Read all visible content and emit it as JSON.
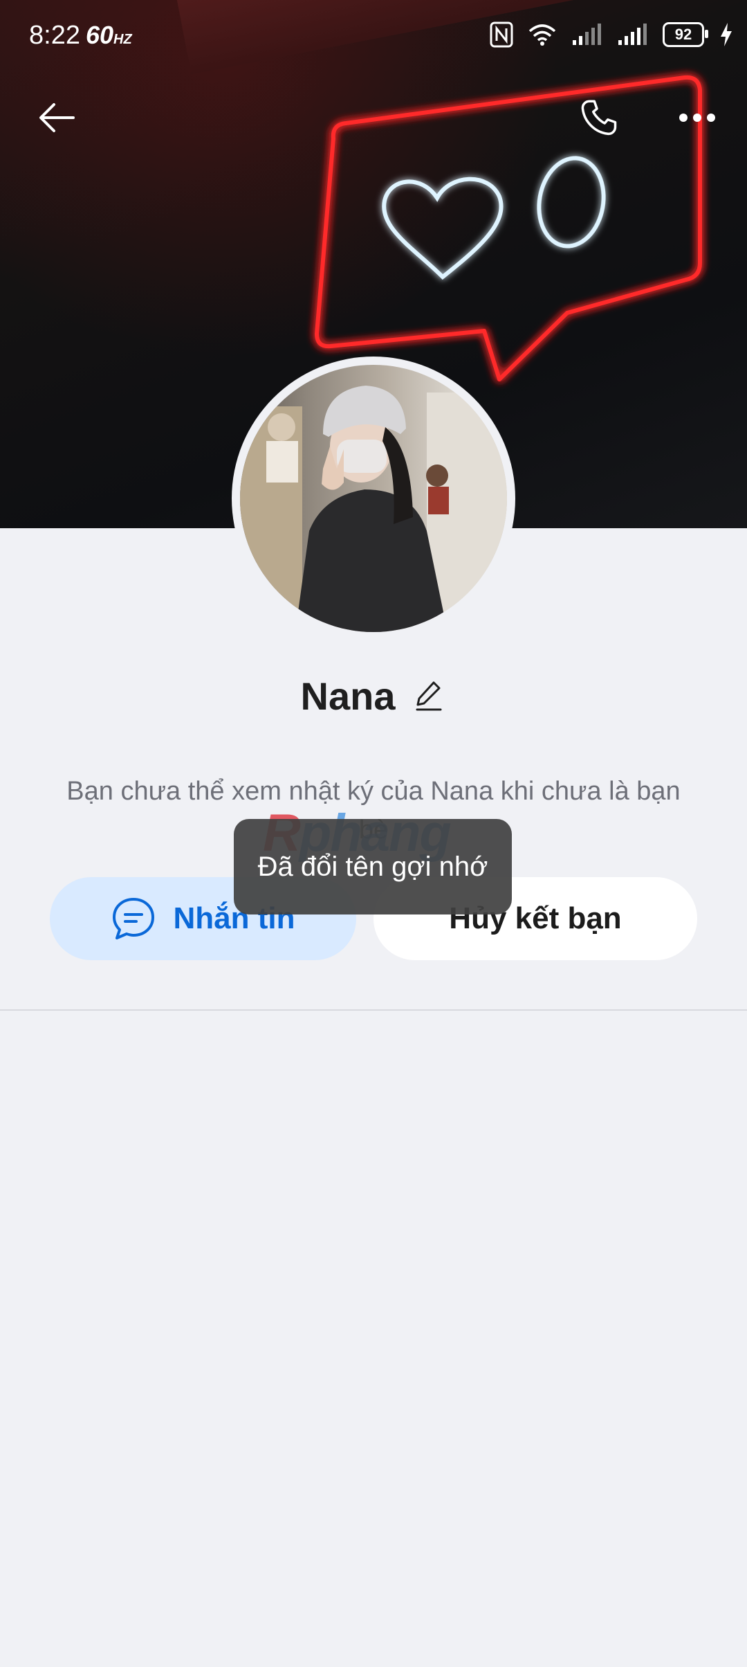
{
  "status_bar": {
    "time": "8:22",
    "refresh": "60",
    "refresh_unit": "HZ",
    "battery": "92",
    "icons": [
      "nfc-icon",
      "wifi-icon",
      "signal-icon",
      "signal-icon",
      "battery-icon",
      "charging-icon"
    ]
  },
  "top_bar": {
    "back_icon": "arrow-left-icon",
    "call_icon": "phone-icon",
    "more_icon": "more-horizontal-icon"
  },
  "profile": {
    "name": "Nana",
    "edit_icon": "pencil-icon",
    "notice": "Bạn chưa thể xem nhật ký của Nana khi chưa là bạn bè"
  },
  "actions": {
    "message_label": "Nhắn tin",
    "message_icon": "chat-bubble-icon",
    "unfriend_label": "Hủy kết bạn"
  },
  "toast": {
    "text": "Đã đổi tên gợi nhớ"
  },
  "watermark": {
    "first": "R",
    "rest": "phang"
  },
  "colors": {
    "accent": "#0a68d8",
    "message_bg": "#d9eaff",
    "page_bg": "#f0f1f5",
    "neon_red": "#ff2a2a",
    "neon_white": "#dff4ff"
  }
}
